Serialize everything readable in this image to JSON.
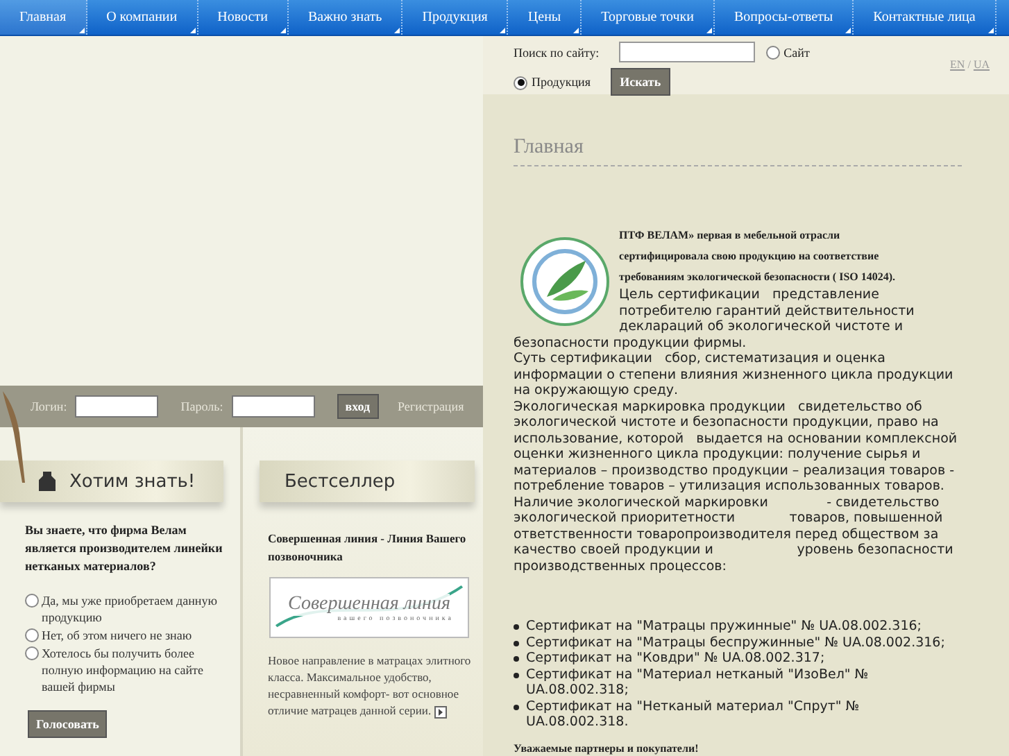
{
  "nav": [
    {
      "label": "Главная",
      "selected": true
    },
    {
      "label": "О компании",
      "selected": false
    },
    {
      "label": "Новости",
      "selected": false
    },
    {
      "label": "Важно знать",
      "selected": false
    },
    {
      "label": "Продукция",
      "selected": false
    },
    {
      "label": "Цены",
      "selected": false
    },
    {
      "label": "Торговые точки",
      "selected": false
    },
    {
      "label": "Вопросы-ответы",
      "selected": false
    },
    {
      "label": "Контактные лица",
      "selected": false
    }
  ],
  "login": {
    "login_label": "Логин:",
    "password_label": "Пароль:",
    "submit": "вход",
    "register": "Регистрация"
  },
  "poll": {
    "title": "Хотим знать!",
    "question": "Вы знаете, что фирма Велам является производителем линейки нетканых материалов?",
    "options": [
      {
        "label": "Да, мы уже приобретаем данную продукцию",
        "selected": false
      },
      {
        "label": "Нет, об этом ничего не знаю",
        "selected": false
      },
      {
        "label": "Хотелось бы получить более полную информацию на сайте вашей фирмы",
        "selected": false
      }
    ],
    "button": "Голосовать"
  },
  "bestseller": {
    "title": "Бестселлер",
    "product": "Совершенная линия - Линия Вашего позвоночника",
    "banner_title": "Совершенная линия",
    "banner_subtitle": "вашего позвоночника",
    "description": "Новое направление в матрацах элитного класса. Максимальное удобство, несравненный комфорт- вот основное отличие матрацев данной серии."
  },
  "search": {
    "label": "Поиск по сайту:",
    "scopes": [
      {
        "label": "Сайт",
        "selected": false
      },
      {
        "label": "Продукция",
        "selected": true
      }
    ],
    "button": "Искать"
  },
  "languages": [
    "EN",
    "UA"
  ],
  "language_separator": "/",
  "content": {
    "title": "Главная",
    "intro": "ПТФ   ВЕЛАМ» первая в мебельной отрасли сертифицировала свою продукцию на соответствие требованиям экологической безопасности ( ISO 14024).",
    "paragraphs": [
      "Цель сертификации   представление потребителю гарантий действительности деклараций об экологической чистоте и безопасности продукции фирмы.",
      "Суть сертификации   сбор, систематизация и оценка информации о степени влияния жизненного цикла продукции на окружающую среду.",
      "Экологическая маркировка продукции   свидетельство об экологической чистоте и безопасности продукции, право на использование, которой   выдается на основании комплексной оценки жизненного цикла продукции: получение сырья и материалов – производство продукции – реализация товаров - потребление товаров – утилизация использованных товаров.",
      "Наличие экологической маркировки              - свидетельство экологической приоритетности             товаров, повышенной ответственности товаропроизводителя перед обществом за качество своей продукции и                    уровень безопасности производственных процессов:"
    ],
    "certificates": [
      "Сертификат на \"Матрацы пружинные\" № UA.08.002.316;",
      "Сертификат на \"Матрацы беспружинные\" № UA.08.002.316;",
      "Сертификат на \"Ковдри\" № UA.08.002.317;",
      "Сертификат на \"Материал нетканый \"ИзоВел\" № UA.08.002.318;",
      "Сертификат на \"Нетканый материал \"Спрут\" № UA.08.002.318."
    ],
    "closing": "Уважаемые партнеры и покупатели!"
  }
}
